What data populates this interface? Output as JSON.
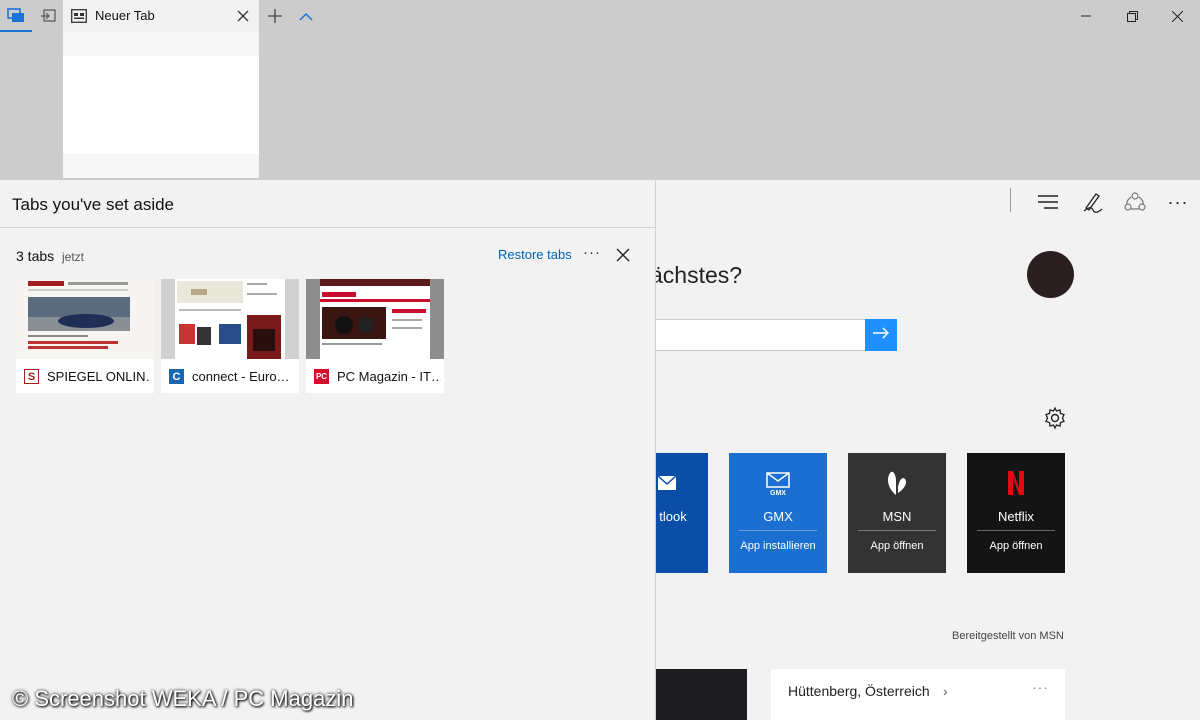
{
  "titlebar": {
    "active_tab": {
      "title": "Neuer Tab",
      "icon": "new-tab-page-icon"
    },
    "icons": [
      "tabs-set-aside-icon",
      "set-tabs-aside-icon",
      "new-tab-plus-icon",
      "show-previews-chevron-icon",
      "minimize-icon",
      "restore-icon",
      "close-icon"
    ]
  },
  "aside_panel": {
    "title": "Tabs you've set aside",
    "group": {
      "count_label": "3 tabs",
      "time_label": "jetzt",
      "restore_label": "Restore tabs",
      "more_label": "···"
    },
    "tabs": [
      {
        "title": "SPIEGEL ONLIN…",
        "favicon_letter": "S",
        "favicon_color": "#a21d1d"
      },
      {
        "title": "connect - Euro…",
        "favicon_letter": "C",
        "favicon_color": "#1566b4"
      },
      {
        "title": "PC Magazin - IT…",
        "favicon_letter": "PC",
        "favicon_color": "#d0112b"
      }
    ]
  },
  "toolbar": {
    "icons": [
      "hub-icon",
      "web-note-icon",
      "share-icon",
      "more-icon"
    ],
    "more_label": "···"
  },
  "page": {
    "headline": "ächstes?",
    "search_button_icon": "arrow-right-icon",
    "settings_icon": "gear-icon",
    "apps": [
      {
        "name": "tlook",
        "action": "",
        "color": "#0a4ea8",
        "icon": "mail-icon"
      },
      {
        "name": "GMX",
        "action": "App installieren",
        "color": "#1a6fd0",
        "icon": "gmx-icon"
      },
      {
        "name": "MSN",
        "action": "App öffnen",
        "color": "#333333",
        "icon": "msn-butterfly-icon"
      },
      {
        "name": "Netflix",
        "action": "App öffnen",
        "color": "#141414",
        "icon": "netflix-icon"
      }
    ],
    "provider_note": "Bereitgestellt von MSN",
    "weather": {
      "location": "Hüttenberg, Österreich",
      "chevron": "›",
      "more": "···"
    }
  },
  "watermark": "© Screenshot WEKA / PC Magazin",
  "colors": {
    "accent": "#0063b1",
    "search_button": "#1e90ff",
    "chrome": "#cccccc"
  }
}
